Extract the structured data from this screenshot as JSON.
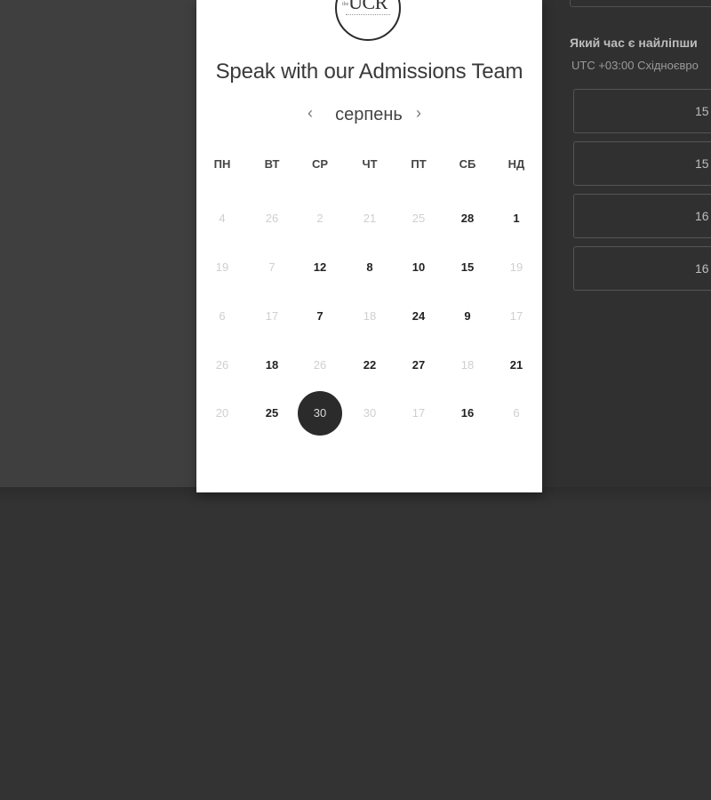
{
  "logo": {
    "prefix": "the",
    "text": "UCR"
  },
  "title": "Speak with our Admissions Team",
  "calendar": {
    "month": "серпень",
    "prev_icon": "‹",
    "next_icon": "›",
    "weekdays": [
      "ПН",
      "ВТ",
      "СР",
      "ЧТ",
      "ПТ",
      "СБ",
      "НД"
    ],
    "weeks": [
      [
        {
          "t": "4",
          "a": false
        },
        {
          "t": "26",
          "a": false
        },
        {
          "t": "2",
          "a": false
        },
        {
          "t": "21",
          "a": false
        },
        {
          "t": "25",
          "a": false
        },
        {
          "t": "28",
          "a": true
        },
        {
          "t": "1",
          "a": true
        }
      ],
      [
        {
          "t": "19",
          "a": false
        },
        {
          "t": "7",
          "a": false
        },
        {
          "t": "12",
          "a": true
        },
        {
          "t": "8",
          "a": true
        },
        {
          "t": "10",
          "a": true
        },
        {
          "t": "15",
          "a": true
        },
        {
          "t": "19",
          "a": false
        }
      ],
      [
        {
          "t": "6",
          "a": false
        },
        {
          "t": "17",
          "a": false
        },
        {
          "t": "7",
          "a": true
        },
        {
          "t": "18",
          "a": false
        },
        {
          "t": "24",
          "a": true
        },
        {
          "t": "9",
          "a": true
        },
        {
          "t": "17",
          "a": false
        }
      ],
      [
        {
          "t": "26",
          "a": false
        },
        {
          "t": "18",
          "a": true
        },
        {
          "t": "26",
          "a": false
        },
        {
          "t": "22",
          "a": true
        },
        {
          "t": "27",
          "a": true
        },
        {
          "t": "18",
          "a": false
        },
        {
          "t": "21",
          "a": true
        }
      ],
      [
        {
          "t": "20",
          "a": false
        },
        {
          "t": "25",
          "a": true
        },
        {
          "t": "30",
          "a": true,
          "selected": true
        },
        {
          "t": "30",
          "a": false
        },
        {
          "t": "17",
          "a": false
        },
        {
          "t": "16",
          "a": true
        },
        {
          "t": "6",
          "a": false
        }
      ]
    ]
  },
  "side": {
    "question": "Який час є найліпши",
    "timezone": "UTC +03:00 Східноєвро",
    "slots": [
      "15",
      "15",
      "16",
      "16"
    ]
  }
}
